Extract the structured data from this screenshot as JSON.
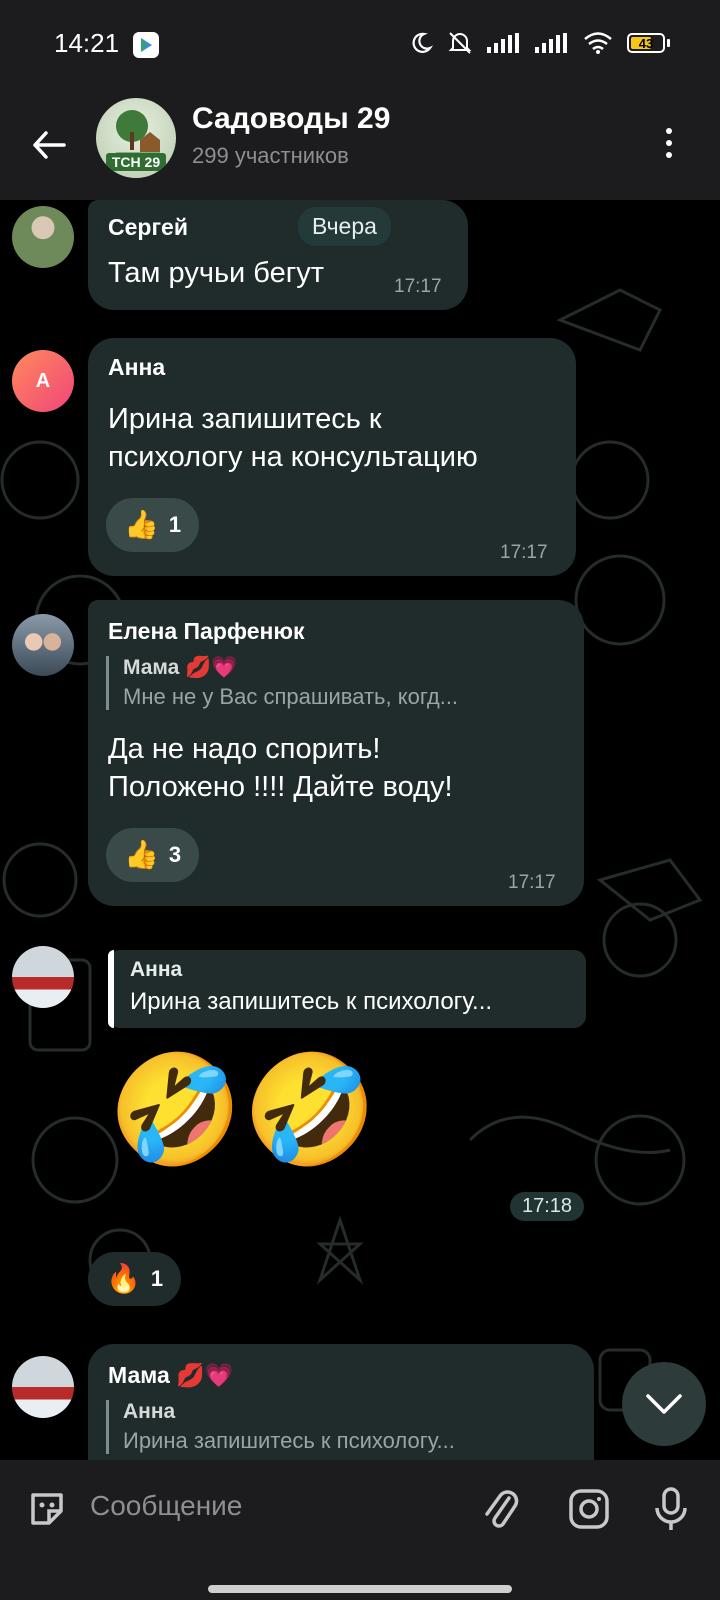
{
  "status_bar": {
    "time": "14:21",
    "battery": "43"
  },
  "header": {
    "title": "Садоводы 29",
    "subtitle": "299 участников",
    "avatar_text": "ТСН 29"
  },
  "date_pill": "Вчера",
  "messages": [
    {
      "sender": "Сергей",
      "text": "Там ручьи бегут",
      "time": "17:17"
    },
    {
      "sender": "Анна",
      "avatar_letter": "А",
      "text_lines": [
        "Ирина запишитесь к",
        "психологу на консультацию"
      ],
      "time": "17:17",
      "reaction": {
        "icon": "thumbs-up-icon",
        "emoji": "👍",
        "count": "1"
      }
    },
    {
      "sender": "Елена Парфенюк",
      "reply": {
        "name": "Мама",
        "name_emoji": "💋💗",
        "text": "Мне не у Вас спрашивать, когд..."
      },
      "text_lines": [
        "Да не надо спорить!",
        "Положено !!!! Дайте воду!"
      ],
      "time": "17:17",
      "reaction": {
        "icon": "thumbs-up-icon",
        "emoji": "👍",
        "count": "3"
      }
    },
    {
      "reply": {
        "name": "Анна",
        "text": "Ирина запишитесь к психологу..."
      },
      "emoji": "🤣🤣",
      "time": "17:18",
      "reaction": {
        "icon": "fire-icon",
        "emoji": "🔥",
        "count": "1"
      }
    },
    {
      "sender": "Мама",
      "sender_emoji": "💋💗",
      "reply": {
        "name": "Анна",
        "text": "Ирина запишитесь к психологу..."
      }
    }
  ],
  "input": {
    "placeholder": "Сообщение"
  }
}
